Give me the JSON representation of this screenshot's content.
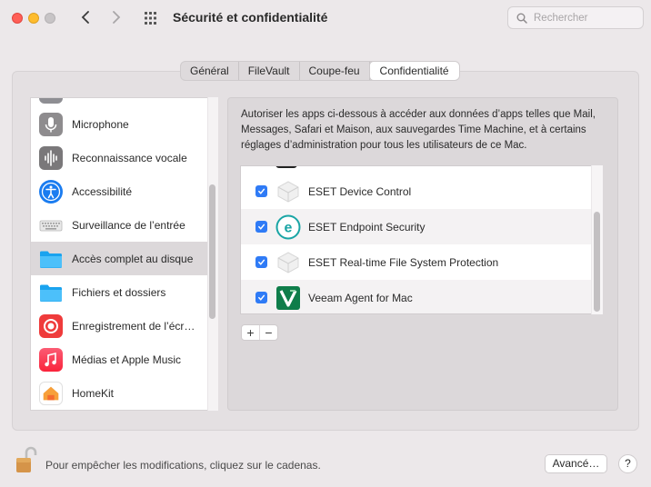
{
  "window": {
    "title": "Sécurité et confidentialité",
    "search_placeholder": "Rechercher"
  },
  "tabs": [
    {
      "label": "Général"
    },
    {
      "label": "FileVault"
    },
    {
      "label": "Coupe-feu"
    },
    {
      "label": "Confidentialité",
      "active": true
    }
  ],
  "sidebar": {
    "items": [
      {
        "label": "Microphone",
        "icon": "microphone-icon"
      },
      {
        "label": "Reconnaissance vocale",
        "icon": "waveform-icon"
      },
      {
        "label": "Accessibilité",
        "icon": "accessibility-icon"
      },
      {
        "label": "Surveillance de l’entrée",
        "icon": "keyboard-icon"
      },
      {
        "label": "Accès complet au disque",
        "icon": "folder-icon",
        "selected": true
      },
      {
        "label": "Fichiers et dossiers",
        "icon": "folder-icon"
      },
      {
        "label": "Enregistrement de l’écr…",
        "icon": "screen-record-icon"
      },
      {
        "label": "Médias et Apple Music",
        "icon": "music-icon"
      },
      {
        "label": "HomeKit",
        "icon": "home-icon"
      }
    ]
  },
  "content": {
    "description": "Autoriser les apps ci-dessous à accéder aux données d’apps telles que Mail, Messages, Safari et Maison, aux sauvegardes Time Machine, et à certains réglages d’administration pour tous les utilisateurs de ce Mac.",
    "apps": [
      {
        "label": "ESET Device Control",
        "checked": true,
        "icon": "eset-generic-icon"
      },
      {
        "label": "ESET Endpoint Security",
        "checked": true,
        "icon": "eset-logo-icon"
      },
      {
        "label": "ESET Real-time File System Protection",
        "checked": true,
        "icon": "eset-generic-icon"
      },
      {
        "label": "Veeam Agent for Mac",
        "checked": true,
        "icon": "veeam-icon"
      }
    ],
    "add_label": "+",
    "remove_label": "−"
  },
  "footer": {
    "lock_text": "Pour empêcher les modifications, cliquez sur le cadenas.",
    "advanced_label": "Avancé…",
    "help_label": "?"
  },
  "colors": {
    "accent": "#2f7bf6",
    "selected_row": "#dcd8da",
    "window_bg": "#ece8ea"
  }
}
